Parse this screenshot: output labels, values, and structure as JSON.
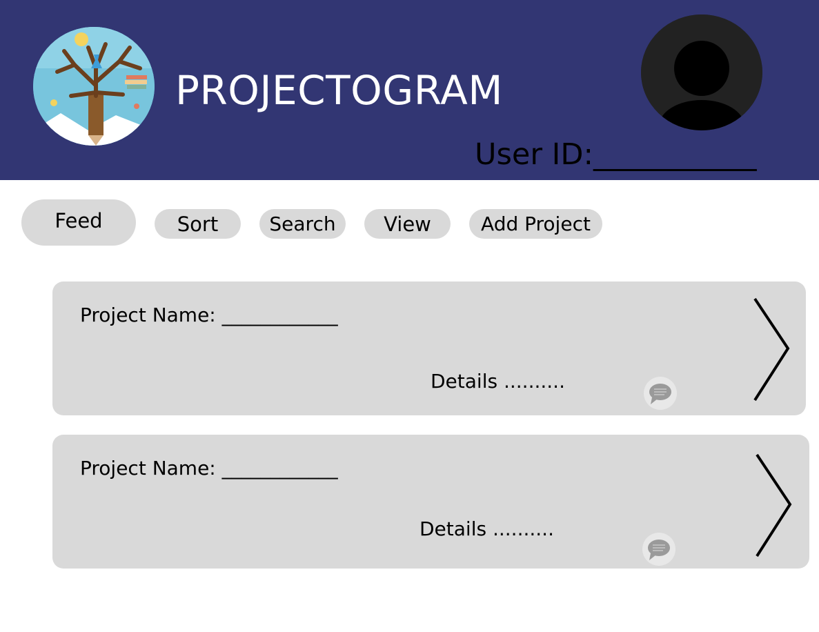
{
  "header": {
    "app_title": "PROJECTOGRAM",
    "user_id_label": "User ID:___________",
    "logo_icon": "tree-pencil-logo",
    "avatar_icon": "user-avatar-icon",
    "background_color": "#323673"
  },
  "nav": {
    "feed": "Feed",
    "sort": "Sort",
    "search": "Search",
    "view": "View",
    "add_project": "Add Project"
  },
  "projects": [
    {
      "name_label": "Project Name: ____________",
      "details": "Details ..........",
      "comment_icon": "comment-icon",
      "open_icon": "chevron-right-icon"
    },
    {
      "name_label": "Project Name: ____________",
      "details": "Details ..........",
      "comment_icon": "comment-icon",
      "open_icon": "chevron-right-icon"
    }
  ]
}
